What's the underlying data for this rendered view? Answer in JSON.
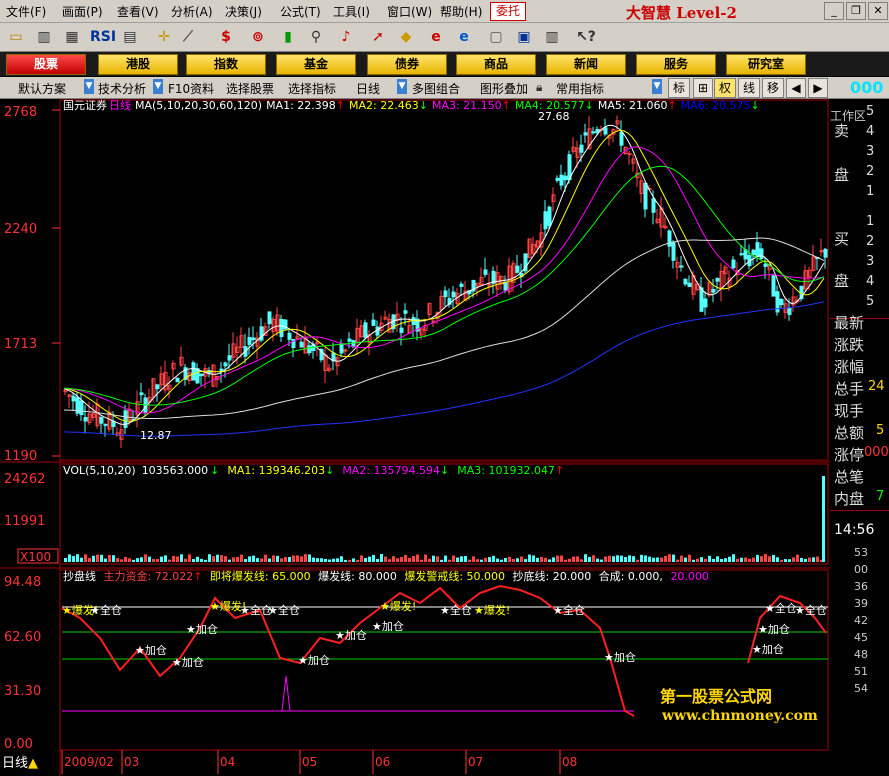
{
  "menu": {
    "items": [
      "文件(F)",
      "画面(P)",
      "查看(V)",
      "分析(A)",
      "决策(J)",
      "公式(T)",
      "工具(I)",
      "窗口(W)",
      "帮助(H)"
    ],
    "entrust": "委托",
    "brand": "大智慧 Level-2"
  },
  "nav": {
    "items": [
      "股票",
      "港股",
      "指数",
      "基金",
      "债券",
      "商品",
      "新闻",
      "服务",
      "研究室"
    ],
    "workarea": "工作区"
  },
  "subbar": {
    "items": [
      "默认方案",
      "技术分析",
      "F10资料",
      "选择股票",
      "选择指标",
      "日线",
      "多图组合",
      "图形叠加",
      "常用指标"
    ],
    "right_tabs": [
      "标",
      "权",
      "线",
      "移"
    ],
    "big_value": "000"
  },
  "main_chart": {
    "stock_name": "国元证券",
    "period": "日线",
    "ma_label": "MA(5,10,20,30,60,120)",
    "ma_values": [
      {
        "label": "MA1:",
        "value": "22.398",
        "color": "#ffffff"
      },
      {
        "label": "MA2:",
        "value": "22.463",
        "color": "#ffff00"
      },
      {
        "label": "MA3:",
        "value": "21.150",
        "color": "#ff00ff"
      },
      {
        "label": "MA4:",
        "value": "20.577",
        "color": "#00ff00"
      },
      {
        "label": "MA5:",
        "value": "21.060",
        "color": "#ffffff"
      },
      {
        "label": "MA6:",
        "value": "20.575",
        "color": "#0000ff"
      }
    ],
    "y_ticks": [
      "2768",
      "2240",
      "1713",
      "1190"
    ],
    "high_label": "27.68",
    "low_label": "12.87"
  },
  "volume": {
    "label": "VOL(5,10,20)",
    "value": "103563.000",
    "ma1": "MA1: 139346.203",
    "ma2": "MA2: 135794.594",
    "ma3": "MA3: 101932.047",
    "y_ticks": [
      "24262",
      "11991"
    ],
    "unit": "X100"
  },
  "indicator": {
    "name": "抄盘线",
    "items": [
      {
        "text": "主力资金: 72.022",
        "color": "#ff4040"
      },
      {
        "text": "即将爆发线: 65.000",
        "color": "#ffff00"
      },
      {
        "text": "爆发线: 80.000",
        "color": "#ffffff"
      },
      {
        "text": "爆发警戒线: 50.000",
        "color": "#ffff00"
      },
      {
        "text": "抄底线: 20.000",
        "color": "#ffffff"
      },
      {
        "text": "合成: 0.000,",
        "color": "#ffffff"
      },
      {
        "text": "20.000",
        "color": "#ff00ff"
      }
    ],
    "y_ticks": [
      "94.48",
      "62.60",
      "31.30",
      "0.00"
    ],
    "signal_full": "★全仓",
    "signal_add": "★加仓",
    "signal_burst": "★爆发!"
  },
  "x_axis": [
    "2009/02",
    "03",
    "04",
    "05",
    "06",
    "07",
    "08"
  ],
  "timeframe": "日线",
  "side": {
    "sell": [
      "卖",
      "盘"
    ],
    "sell_nums": [
      "5",
      "4",
      "3",
      "2",
      "1"
    ],
    "buy": [
      "买",
      "盘"
    ],
    "buy_nums": [
      "1",
      "2",
      "3",
      "4",
      "5"
    ],
    "labels": [
      "最新",
      "涨跌",
      "涨幅",
      "总手",
      "现手",
      "总额",
      "涨停",
      "总笔",
      "内盘"
    ],
    "values": [
      "",
      "",
      "",
      "24",
      "",
      "5",
      "000",
      "",
      "7"
    ],
    "time": "14:56",
    "ticks": [
      "53",
      "00",
      "36",
      "39",
      "42",
      "45",
      "48",
      "51",
      "54"
    ]
  },
  "watermark": {
    "title": "第一股票公式网",
    "url": "www.chnmoney.com"
  }
}
